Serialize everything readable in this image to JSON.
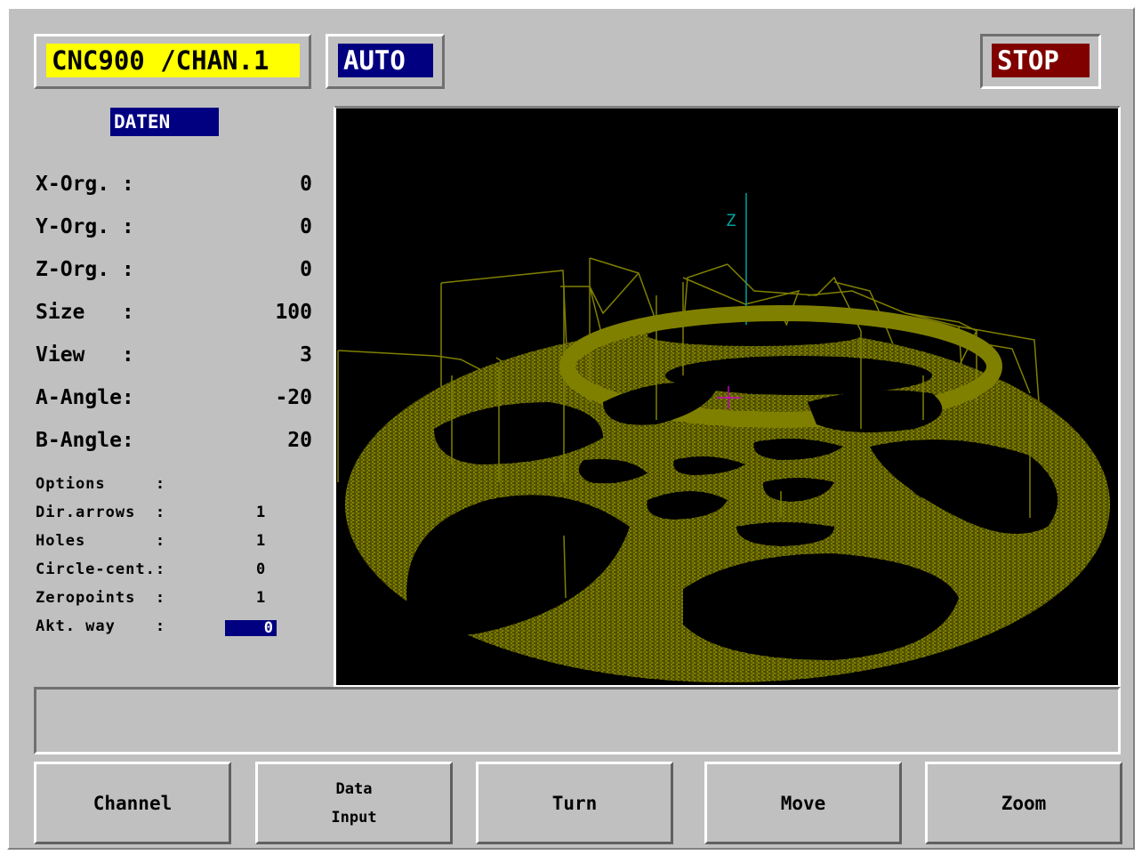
{
  "header": {
    "channel_label": "CNC900 /CHAN.1",
    "mode_label": "AUTO",
    "stop_label": "STOP"
  },
  "panel": {
    "title": "DATEN",
    "fields": [
      {
        "label": "X-Org. :",
        "value": "0"
      },
      {
        "label": "Y-Org. :",
        "value": "0"
      },
      {
        "label": "Z-Org. :",
        "value": "0"
      },
      {
        "label": "Size   :",
        "value": "100"
      },
      {
        "label": "View   :",
        "value": "3"
      },
      {
        "label": "A-Angle:",
        "value": "-20"
      },
      {
        "label": "B-Angle:",
        "value": "20"
      }
    ],
    "options": [
      {
        "label": "Options     :",
        "value": ""
      },
      {
        "label": "Dir.arrows  :",
        "value": "1"
      },
      {
        "label": "Holes       :",
        "value": "1"
      },
      {
        "label": "Circle-cent.:",
        "value": "0"
      },
      {
        "label": "Zeropoints  :",
        "value": "1"
      },
      {
        "label": "Akt. way    :",
        "value": "0"
      }
    ]
  },
  "viewport": {
    "axis_label": "Z",
    "wire_color": "#808000",
    "axis_color": "#00a0a0",
    "marker_color": "#c000c0",
    "background": "#000000"
  },
  "message_bar": {
    "text": ""
  },
  "softkeys": [
    {
      "line1": "Channel",
      "line2": ""
    },
    {
      "line1": "Data",
      "line2": "Input"
    },
    {
      "line1": "Turn",
      "line2": ""
    },
    {
      "line1": "Move",
      "line2": ""
    },
    {
      "line1": "Zoom",
      "line2": ""
    }
  ],
  "colors": {
    "channel_bg": "#ffff00",
    "mode_bg": "#000080",
    "stop_bg": "#800000",
    "panel_bg": "#c0c0c0"
  }
}
